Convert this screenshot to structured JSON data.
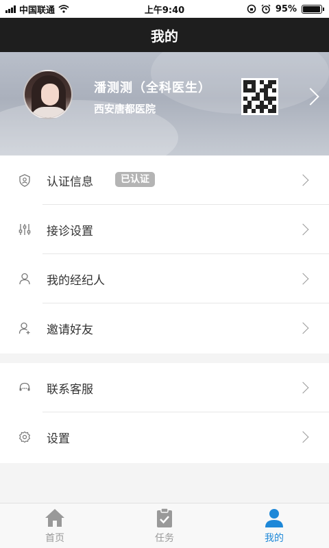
{
  "status_bar": {
    "carrier": "中国联通",
    "time": "上午9:40",
    "battery": "95%",
    "battery_level": 0.95
  },
  "nav": {
    "title": "我的"
  },
  "profile": {
    "name": "潘测测（全科医生）",
    "hospital": "西安唐都医院"
  },
  "menu_group1": [
    {
      "label": "认证信息",
      "badge": "已认证",
      "icon": "shield-person-icon"
    },
    {
      "label": "接诊设置",
      "icon": "sliders-icon"
    },
    {
      "label": "我的经纪人",
      "icon": "person-icon"
    },
    {
      "label": "邀请好友",
      "icon": "add-person-icon"
    }
  ],
  "menu_group2": [
    {
      "label": "联系客服",
      "icon": "headset-icon"
    },
    {
      "label": "设置",
      "icon": "gear-icon"
    }
  ],
  "tabbar": [
    {
      "label": "首页",
      "icon": "home-icon",
      "active": false
    },
    {
      "label": "任务",
      "icon": "clipboard-check-icon",
      "active": false
    },
    {
      "label": "我的",
      "icon": "user-icon",
      "active": true
    }
  ],
  "colors": {
    "nav_bg": "#1e1e1e",
    "accent": "#1e88d8",
    "badge_bg": "#b4b4b4"
  }
}
